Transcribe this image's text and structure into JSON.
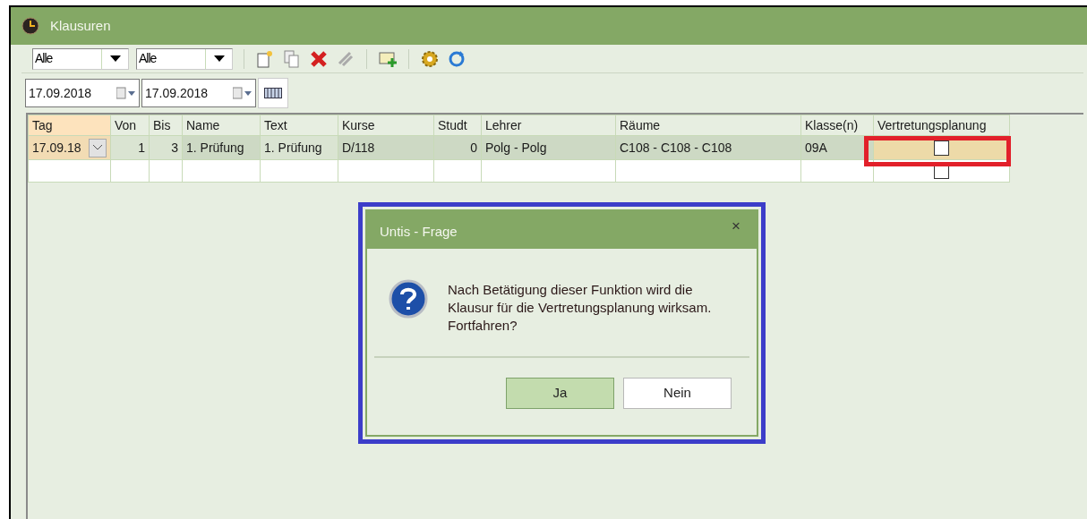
{
  "window": {
    "title": "Klausuren"
  },
  "filters": [
    {
      "value": "Alle"
    },
    {
      "value": "Alle"
    }
  ],
  "dates": [
    {
      "value": "17.09.2018"
    },
    {
      "value": "17.09.2018"
    }
  ],
  "table": {
    "columns": [
      "Tag",
      "Von",
      "Bis",
      "Name",
      "Text",
      "Kurse",
      "Studt",
      "Lehrer",
      "Räume",
      "Klasse(n)",
      "Vertretungsplanung"
    ],
    "rows": [
      {
        "selected": true,
        "cells": [
          "17.09.18",
          "1",
          "3",
          "1. Prüfung",
          "1. Prüfung",
          "D/118",
          "0",
          "Polg - Polg",
          "C108 - C108 - C108",
          "09A"
        ],
        "checked": false
      },
      {
        "selected": false,
        "cells": [],
        "checked": false
      }
    ]
  },
  "dialog": {
    "title": "Untis - Frage",
    "close": "×",
    "message": "Nach Betätigung dieser Funktion wird die Klausur für die Vertretungsplanung wirksam. Fortfahren?",
    "buttons": [
      {
        "label": "Ja",
        "default": true
      },
      {
        "label": "Nein",
        "default": false
      }
    ]
  }
}
